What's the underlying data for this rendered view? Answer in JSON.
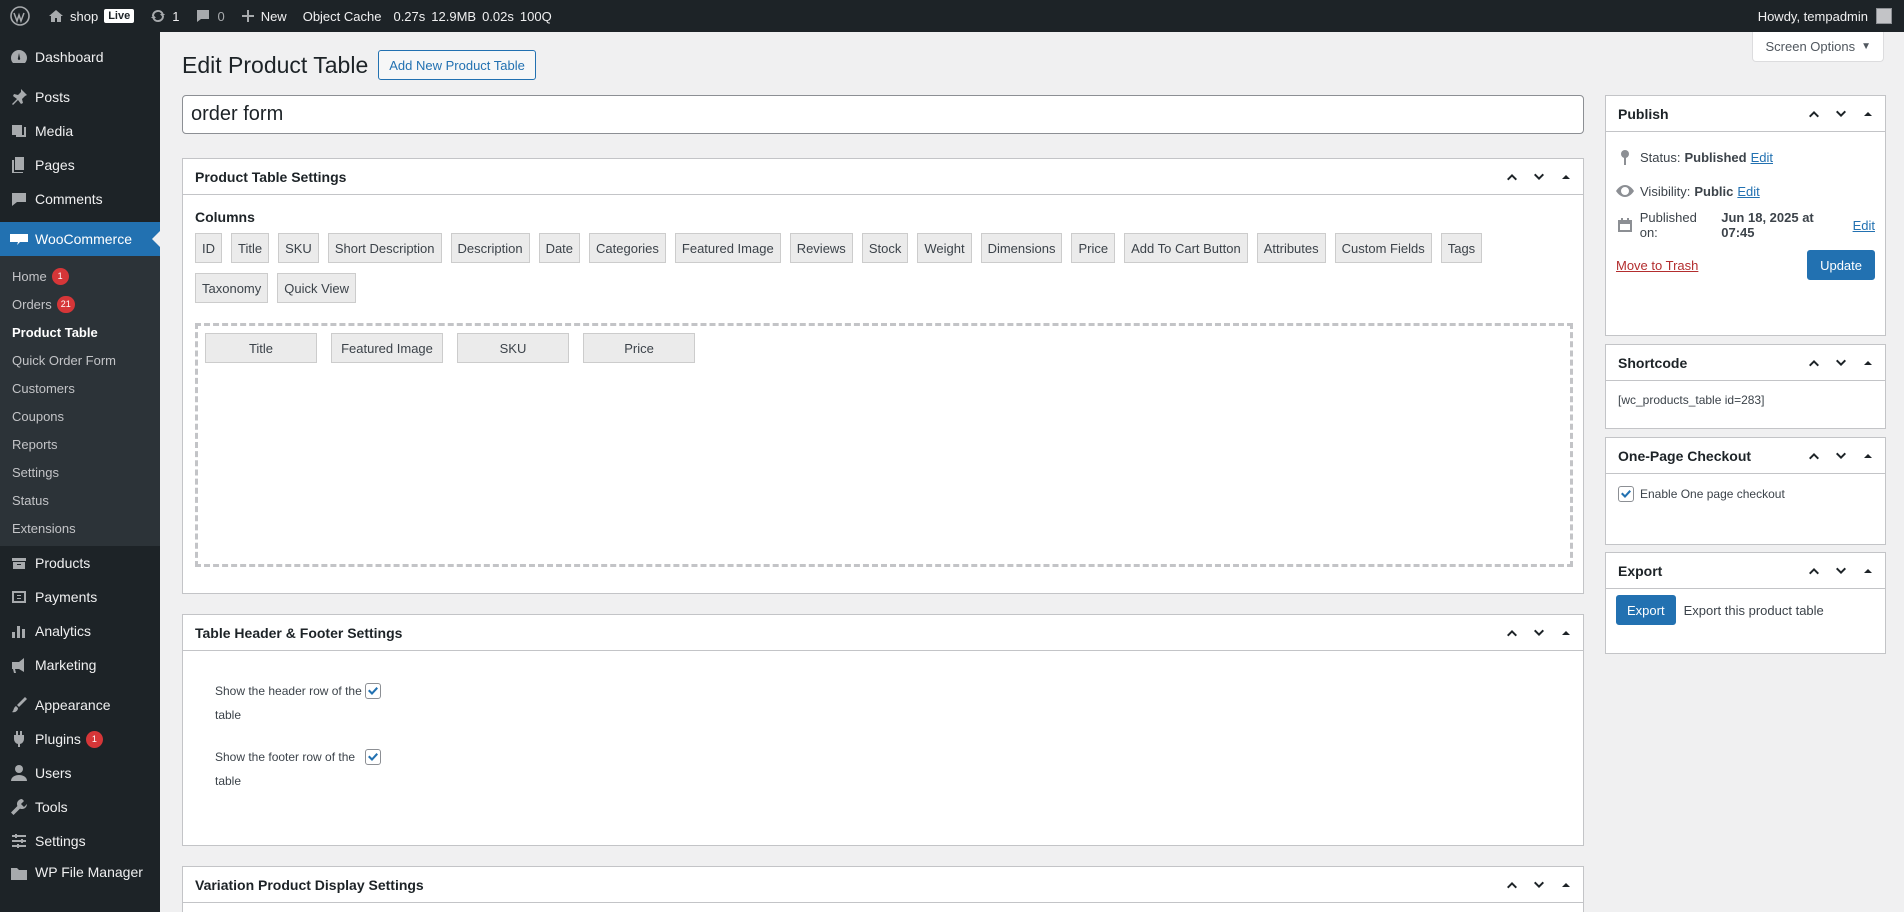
{
  "adminbar": {
    "site_name": "shop",
    "live": "Live",
    "updates_count": "1",
    "comments_count": "0",
    "new_label": "New",
    "object_cache": "Object Cache",
    "perf": "0.27s",
    "memory": "12.9MB",
    "query_time": "0.02s",
    "queries": "100Q",
    "greeting": "Howdy, tempadmin"
  },
  "sidebar": {
    "dashboard": "Dashboard",
    "posts": "Posts",
    "media": "Media",
    "pages": "Pages",
    "comments": "Comments",
    "woocommerce": "WooCommerce",
    "sub": {
      "home": "Home",
      "home_count": "1",
      "orders": "Orders",
      "orders_count": "21",
      "product_table": "Product Table",
      "quick_order_form": "Quick Order Form",
      "customers": "Customers",
      "coupons": "Coupons",
      "reports": "Reports",
      "settings": "Settings",
      "status": "Status",
      "extensions": "Extensions"
    },
    "products": "Products",
    "payments": "Payments",
    "analytics": "Analytics",
    "marketing": "Marketing",
    "appearance": "Appearance",
    "plugins": "Plugins",
    "plugins_count": "1",
    "users": "Users",
    "tools": "Tools",
    "settings": "Settings",
    "wp_file_manager": "WP File Manager"
  },
  "page": {
    "title": "Edit Product Table",
    "add_new": "Add New Product Table",
    "screen_options": "Screen Options",
    "post_title": "order form"
  },
  "settings_box": {
    "title": "Product Table Settings",
    "columns_label": "Columns",
    "available_columns": [
      "ID",
      "Title",
      "SKU",
      "Short Description",
      "Description",
      "Date",
      "Categories",
      "Featured Image",
      "Reviews",
      "Stock",
      "Weight",
      "Dimensions",
      "Price",
      "Add To Cart Button",
      "Attributes",
      "Custom Fields",
      "Tags",
      "Taxonomy",
      "Quick View"
    ],
    "selected_columns": [
      "Title",
      "Featured Image",
      "SKU",
      "Price"
    ]
  },
  "header_footer_box": {
    "title": "Table Header & Footer Settings",
    "show_header": "Show the header row of the table",
    "show_footer": "Show the footer row of the table"
  },
  "variation_box": {
    "title": "Variation Product Display Settings"
  },
  "publish": {
    "title": "Publish",
    "status_label": "Status:",
    "status_value": "Published",
    "visibility_label": "Visibility:",
    "visibility_value": "Public",
    "published_label": "Published on:",
    "published_value": "Jun 18, 2025 at 07:45",
    "edit": "Edit",
    "trash": "Move to Trash",
    "update": "Update"
  },
  "shortcode": {
    "title": "Shortcode",
    "value": "[wc_products_table id=283]"
  },
  "one_page_checkout": {
    "title": "One-Page Checkout",
    "label": "Enable One page checkout"
  },
  "export": {
    "title": "Export",
    "button": "Export",
    "text": "Export this product table"
  },
  "colors": {
    "admin_bar": "#1d2327",
    "accent": "#2271b1",
    "badge": "#d63638"
  }
}
